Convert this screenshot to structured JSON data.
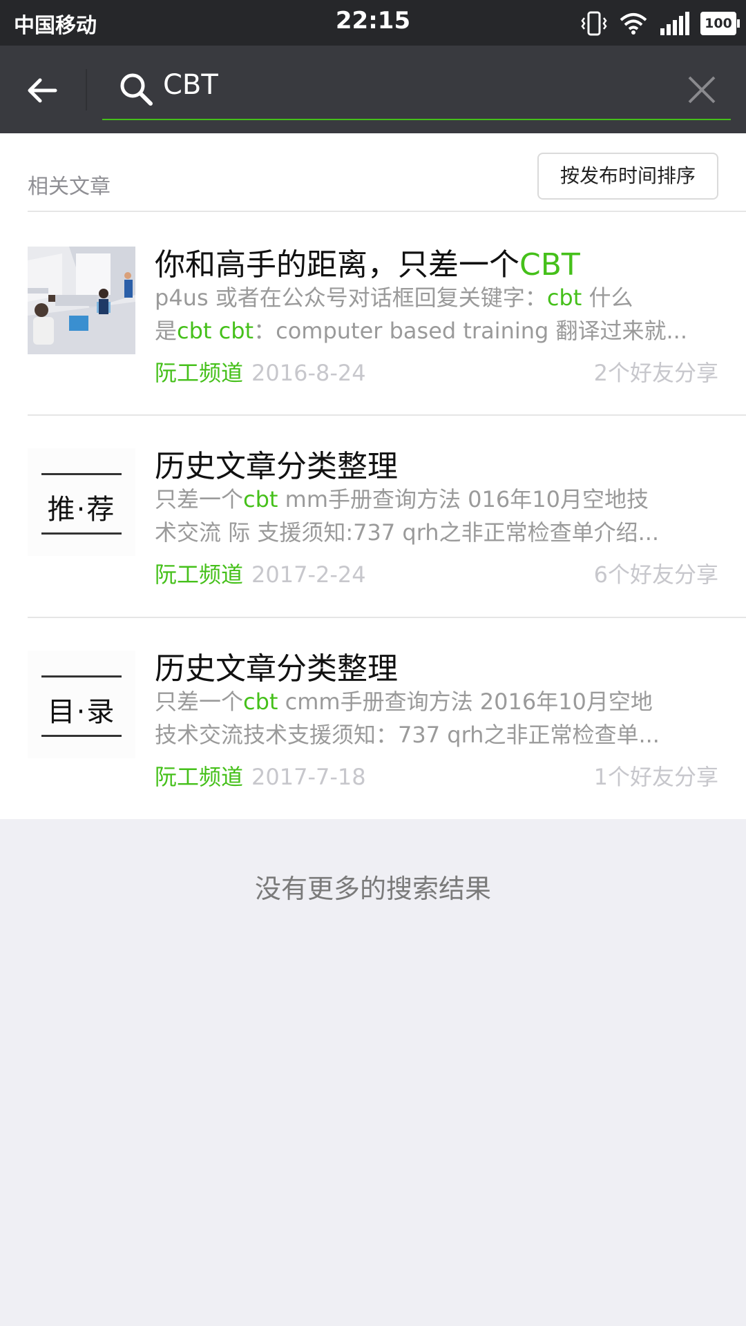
{
  "status_bar": {
    "carrier": "中国移动",
    "time": "22:15",
    "battery": "100"
  },
  "search": {
    "query": "CBT"
  },
  "section": {
    "title": "相关文章",
    "sort_label": "按发布时间排序"
  },
  "results": [
    {
      "title_pre": "你和高手的距离，只差一个",
      "title_hl": "CBT",
      "line1": [
        {
          "t": "p4us 或者在公众号对话框回复关键字：",
          "h": false
        },
        {
          "t": "cbt",
          "h": true
        },
        {
          "t": " 什么",
          "h": false
        }
      ],
      "line2": [
        {
          "t": "是",
          "h": false
        },
        {
          "t": "cbt cbt",
          "h": true
        },
        {
          "t": "：computer based training 翻译过来就...",
          "h": false
        }
      ],
      "source": "阮工频道",
      "date": "2016-8-24",
      "shares": "2个好友分享",
      "thumb_text": ""
    },
    {
      "title_pre": "历史文章分类整理",
      "title_hl": "",
      "line1": [
        {
          "t": "只差一个",
          "h": false
        },
        {
          "t": "cbt",
          "h": true
        },
        {
          "t": " mm手册查询方法 016年10月空地技",
          "h": false
        }
      ],
      "line2": [
        {
          "t": "术交流 际 支援须知:737 qrh之非正常检查单介绍...",
          "h": false
        }
      ],
      "source": "阮工频道",
      "date": "2017-2-24",
      "shares": "6个好友分享",
      "thumb_text": "推·荐"
    },
    {
      "title_pre": "历史文章分类整理",
      "title_hl": "",
      "line1": [
        {
          "t": "只差一个",
          "h": false
        },
        {
          "t": "cbt",
          "h": true
        },
        {
          "t": " cmm手册查询方法 2016年10月空地",
          "h": false
        }
      ],
      "line2": [
        {
          "t": "技术交流技术支援须知：737 qrh之非正常检查单...",
          "h": false
        }
      ],
      "source": "阮工频道",
      "date": "2017-7-18",
      "shares": "1个好友分享",
      "thumb_text": "目·录"
    }
  ],
  "footer": {
    "no_more": "没有更多的搜索结果"
  }
}
